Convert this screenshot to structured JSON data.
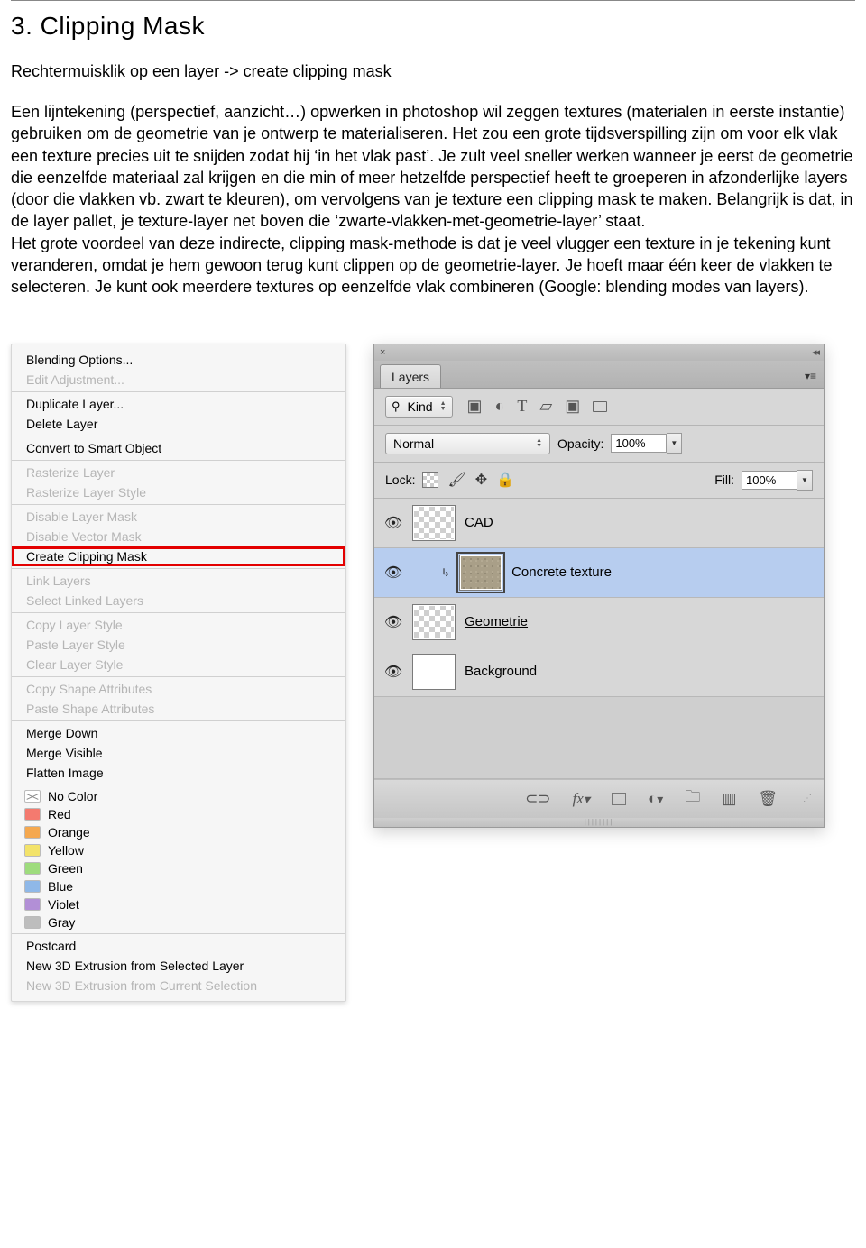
{
  "section": {
    "heading": "3. Clipping Mask",
    "intro": "Rechtermuisklik op een layer -> create clipping mask",
    "body": "Een lijntekening (perspectief, aanzicht…) opwerken in photoshop wil zeggen textures (materialen in eerste instantie) gebruiken om de geometrie van je ontwerp te materialiseren. Het zou een grote tijdsverspilling zijn om voor elk vlak een texture precies uit te snijden zodat hij ‘in het vlak past’. Je zult veel sneller werken wanneer je eerst de geometrie die eenzelfde materiaal zal krijgen en die min of meer hetzelfde perspectief heeft te groeperen in afzonderlijke layers (door die vlakken vb. zwart te kleuren), om vervolgens van je texture een clipping mask te maken. Belangrijk is dat, in de layer pallet, je texture-layer net boven die ‘zwarte-vlakken-met-geometrie-layer’ staat.\nHet grote voordeel van deze indirecte, clipping mask-methode is dat je veel vlugger een texture in je tekening kunt veranderen, omdat je hem gewoon terug kunt clippen op de geometrie-layer. Je hoeft maar één keer de vlakken te selecteren. Je kunt ook meerdere textures op eenzelfde vlak combineren (Google: blending modes van layers)."
  },
  "context_menu": {
    "groups": [
      [
        {
          "label": "Blending Options...",
          "enabled": true
        },
        {
          "label": "Edit Adjustment...",
          "enabled": false
        }
      ],
      [
        {
          "label": "Duplicate Layer...",
          "enabled": true
        },
        {
          "label": "Delete Layer",
          "enabled": true
        }
      ],
      [
        {
          "label": "Convert to Smart Object",
          "enabled": true
        }
      ],
      [
        {
          "label": "Rasterize Layer",
          "enabled": false
        },
        {
          "label": "Rasterize Layer Style",
          "enabled": false
        }
      ],
      [
        {
          "label": "Disable Layer Mask",
          "enabled": false
        },
        {
          "label": "Disable Vector Mask",
          "enabled": false
        },
        {
          "label": "Create Clipping Mask",
          "enabled": true,
          "highlight": true
        }
      ],
      [
        {
          "label": "Link Layers",
          "enabled": false
        },
        {
          "label": "Select Linked Layers",
          "enabled": false
        }
      ],
      [
        {
          "label": "Copy Layer Style",
          "enabled": false
        },
        {
          "label": "Paste Layer Style",
          "enabled": false
        },
        {
          "label": "Clear Layer Style",
          "enabled": false
        }
      ],
      [
        {
          "label": "Copy Shape Attributes",
          "enabled": false
        },
        {
          "label": "Paste Shape Attributes",
          "enabled": false
        }
      ],
      [
        {
          "label": "Merge Down",
          "enabled": true
        },
        {
          "label": "Merge Visible",
          "enabled": true
        },
        {
          "label": "Flatten Image",
          "enabled": true
        }
      ]
    ],
    "colors": [
      {
        "label": "No Color",
        "swatch": "none"
      },
      {
        "label": "Red",
        "swatch": "#f47a6f"
      },
      {
        "label": "Orange",
        "swatch": "#f5a84f"
      },
      {
        "label": "Yellow",
        "swatch": "#f3e36a"
      },
      {
        "label": "Green",
        "swatch": "#9edc7d"
      },
      {
        "label": "Blue",
        "swatch": "#8fb8e8"
      },
      {
        "label": "Violet",
        "swatch": "#b28fd6"
      },
      {
        "label": "Gray",
        "swatch": "#bdbdbd"
      }
    ],
    "three_d": [
      {
        "label": "Postcard",
        "enabled": true
      },
      {
        "label": "New 3D Extrusion from Selected Layer",
        "enabled": true
      },
      {
        "label": "New 3D Extrusion from Current Selection",
        "enabled": false
      }
    ]
  },
  "layers_panel": {
    "tab": "Layers",
    "kind_label": "Kind",
    "blend_mode": "Normal",
    "opacity_label": "Opacity:",
    "opacity_value": "100%",
    "lock_label": "Lock:",
    "fill_label": "Fill:",
    "fill_value": "100%",
    "layers": [
      {
        "name": "CAD",
        "visible": true,
        "thumb": "trans"
      },
      {
        "name": "Concrete texture",
        "visible": true,
        "thumb": "concrete",
        "clipped": true,
        "smart": true,
        "selected": true
      },
      {
        "name": "Geometrie",
        "visible": true,
        "thumb": "trans",
        "underline": true
      },
      {
        "name": "Background",
        "visible": true,
        "thumb": "white"
      }
    ]
  }
}
